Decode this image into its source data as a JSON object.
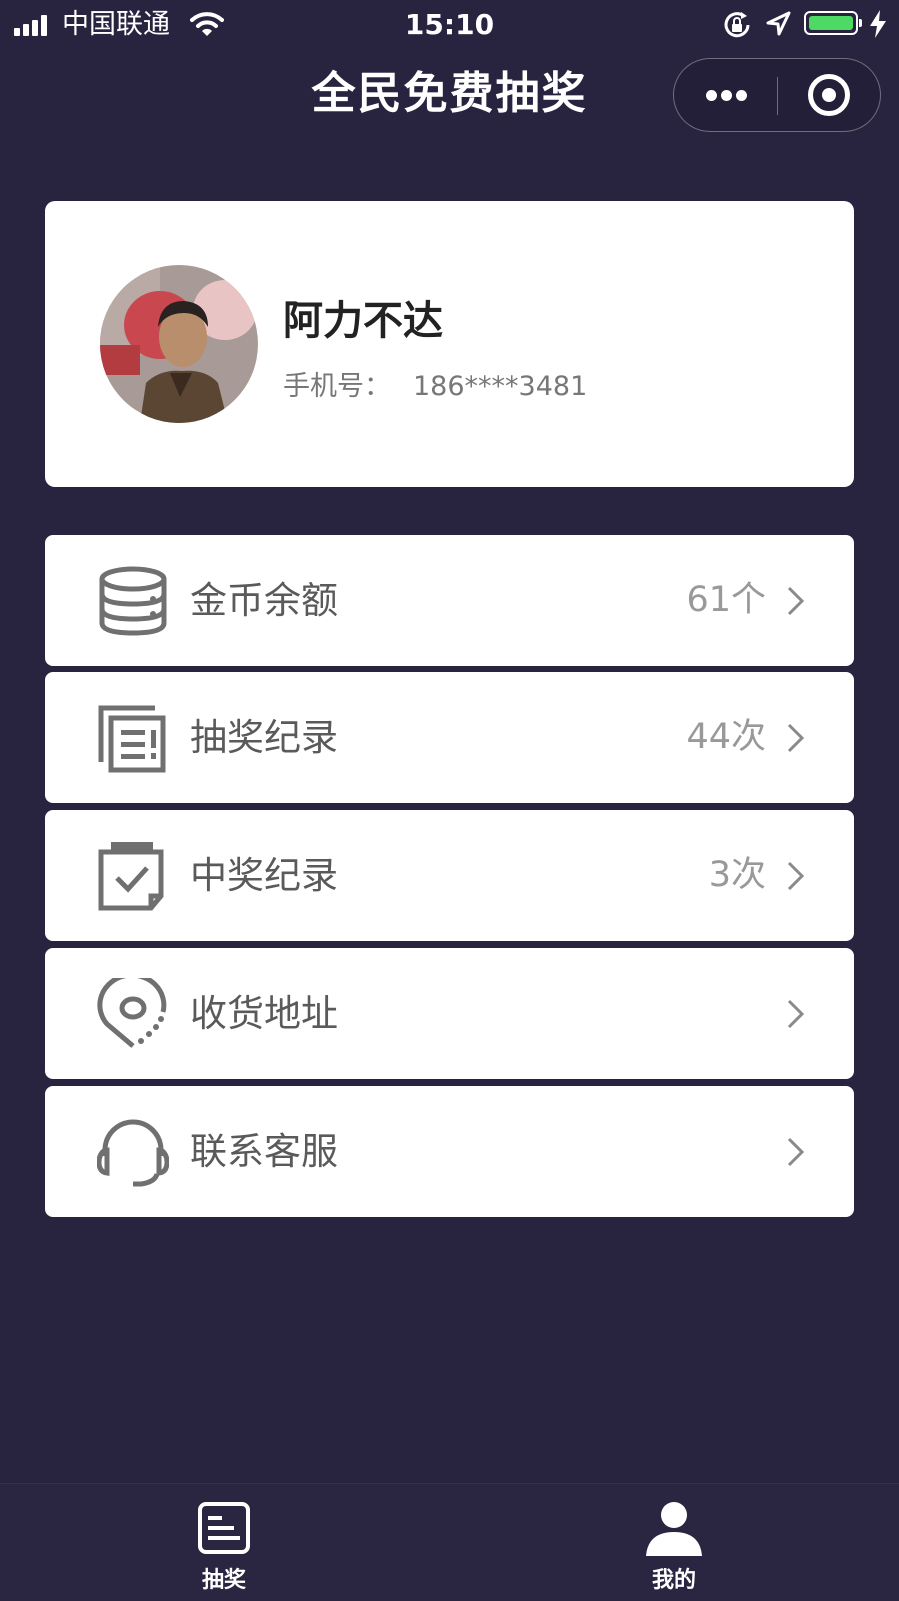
{
  "status_bar": {
    "carrier": "中国联通",
    "time": "15:10",
    "battery_color": "#4cd964"
  },
  "nav": {
    "title": "全民免费抽奖",
    "more_icon": "more-dots-icon",
    "close_icon": "target-close-icon"
  },
  "profile": {
    "name": "阿力不达",
    "phone_label": "手机号：",
    "phone": "186****3481"
  },
  "menu": {
    "items": [
      {
        "icon": "coin-stack-icon",
        "label": "金币余额",
        "value": "61个"
      },
      {
        "icon": "document-list-icon",
        "label": "抽奖纪录",
        "value": "44次"
      },
      {
        "icon": "clipboard-check-icon",
        "label": "中奖纪录",
        "value": "3次"
      },
      {
        "icon": "location-pin-icon",
        "label": "收货地址",
        "value": ""
      },
      {
        "icon": "headset-icon",
        "label": "联系客服",
        "value": ""
      }
    ]
  },
  "tab_bar": {
    "tabs": [
      {
        "icon": "lottery-list-icon",
        "label": "抽奖"
      },
      {
        "icon": "user-profile-icon",
        "label": "我的"
      }
    ]
  },
  "colors": {
    "background": "#282440",
    "card": "#ffffff",
    "menu_text": "#5a5a5a",
    "value_text": "#999999"
  }
}
